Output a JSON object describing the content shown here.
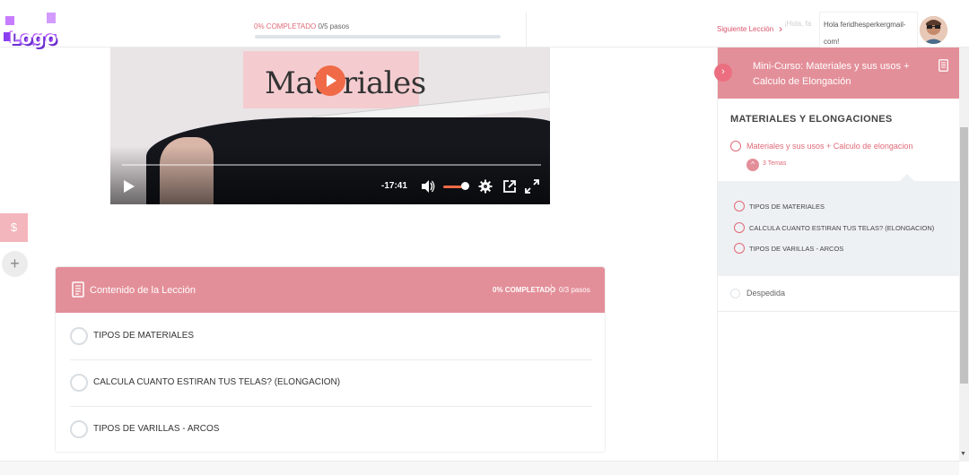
{
  "header": {
    "logo_text": "Logo",
    "progress_pct": "0% COMPLETADO",
    "progress_steps": "0/5 pasos",
    "progress_value": 0,
    "next_lesson_label": "Siguiente Lección",
    "greeting_partial": "¡Hola, fa",
    "user_text": "Hola feridhesperkergmail-com!"
  },
  "video": {
    "title": "Materiales",
    "time_remaining": "-17:41"
  },
  "side_buttons": {
    "dollar": "$",
    "plus": "+"
  },
  "lesson_content": {
    "title": "Contenido de la Lección",
    "pct": "0% COMPLETADO",
    "steps": "0/3 pasos",
    "items": [
      {
        "label": "TIPOS DE MATERIALES"
      },
      {
        "label": "CALCULA CUANTO ESTIRAN TUS TELAS? (ELONGACION)"
      },
      {
        "label": "TIPOS DE VARILLAS - ARCOS"
      }
    ]
  },
  "sidebar": {
    "course_title": "Mini-Curso: Materiales y sus usos + Calculo de Elongación",
    "section_title": "MATERIALES Y ELONGACIONES",
    "lesson": "Materiales y sus usos + Calculo de elongacion",
    "temas_count": "3 Temas",
    "topics": [
      {
        "label": "TIPOS DE MATERIALES"
      },
      {
        "label": "CALCULA CUANTO ESTIRAN TUS TELAS? (ELONGACION)"
      },
      {
        "label": "TIPOS DE VARILLAS - ARCOS"
      }
    ],
    "despedida": "Despedida"
  },
  "colors": {
    "accent": "#e38f99",
    "accent_text": "#e06a77",
    "video_accent": "#f06a47"
  }
}
